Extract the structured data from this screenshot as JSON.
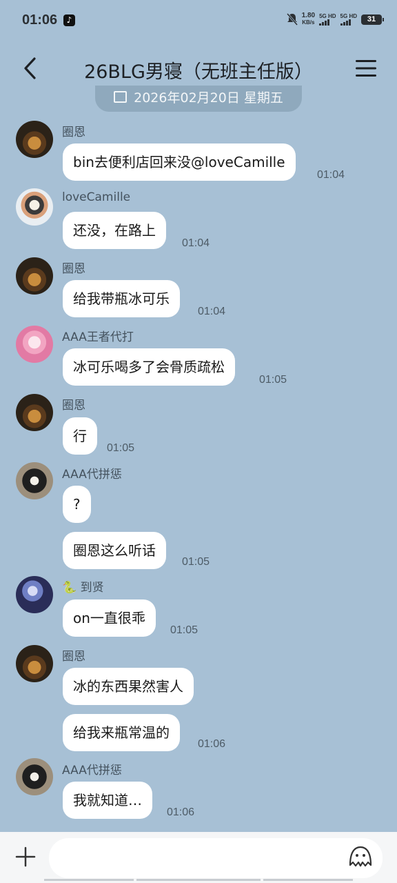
{
  "status": {
    "time": "01:06",
    "speed": "1.80",
    "speed_unit": "KB/s",
    "sig1": "5G HD",
    "sig2": "5G HD",
    "battery": "31"
  },
  "header": {
    "title": "26BLG男寝（无班主任版）"
  },
  "date_divider": "2026年02月20日 星期五",
  "messages": [
    {
      "sender": "圈恩",
      "text": "bin去便利店回来没@loveCamille",
      "time": "01:04"
    },
    {
      "sender": "loveCamille",
      "text": "还没，在路上",
      "time": "01:04"
    },
    {
      "sender": "圈恩",
      "text": "给我带瓶冰可乐",
      "time": "01:04"
    },
    {
      "sender": "AAA王者代打",
      "text": "冰可乐喝多了会骨质疏松",
      "time": "01:05"
    },
    {
      "sender": "圈恩",
      "text": "行",
      "time": "01:05"
    },
    {
      "sender": "AAA代拼惩",
      "text": "?",
      "time": ""
    },
    {
      "sender": "",
      "text": "圈恩这么听话",
      "time": "01:05"
    },
    {
      "sender": "🐍 到贤",
      "text": "on一直很乖",
      "time": "01:05"
    },
    {
      "sender": "圈恩",
      "text": "冰的东西果然害人",
      "time": ""
    },
    {
      "sender": "",
      "text": "给我来瓶常温的",
      "time": "01:06"
    },
    {
      "sender": "AAA代拼惩",
      "text": "我就知道…",
      "time": "01:06"
    }
  ],
  "input": {
    "placeholder": ""
  },
  "colors": {
    "background": "#a7c0d5",
    "bubble": "#ffffff",
    "date_pill": "#8fa9bd"
  },
  "icons": [
    "back-icon",
    "menu-icon",
    "calendar-icon",
    "plus-icon",
    "emoji-icon",
    "tiktok-icon"
  ]
}
